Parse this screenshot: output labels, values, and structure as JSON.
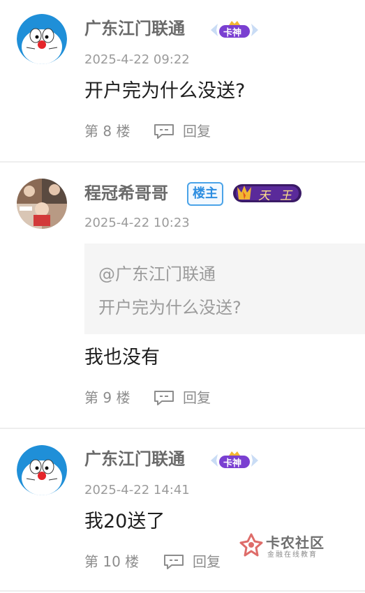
{
  "posts": [
    {
      "username": "广东江门联通",
      "badge": "卡神",
      "time": "2025-4-22 09:22",
      "content": "开户完为什么没送?",
      "floor": "第 8 楼",
      "reply": "回复",
      "avatar": "doraemon-avatar"
    },
    {
      "username": "程冠希哥哥",
      "badge_owner": "楼主",
      "badge": "天王",
      "time": "2025-4-22 10:23",
      "quote": {
        "at": "@广东江门联通",
        "text": "开户完为什么没送?"
      },
      "content": "我也没有",
      "floor": "第 9 楼",
      "reply": "回复",
      "avatar": "photo-collage-avatar"
    },
    {
      "username": "广东江门联通",
      "badge": "卡神",
      "time": "2025-4-22 14:41",
      "content": "我20送了",
      "floor": "第 10 楼",
      "reply": "回复",
      "avatar": "doraemon-avatar"
    }
  ],
  "watermark": {
    "title": "卡农社区",
    "subtitle": "金融在线教育"
  },
  "colors": {
    "accent_blue": "#2c8de0",
    "text_gray": "#8c8c8c",
    "badge_purple": "#7a3fd1"
  }
}
